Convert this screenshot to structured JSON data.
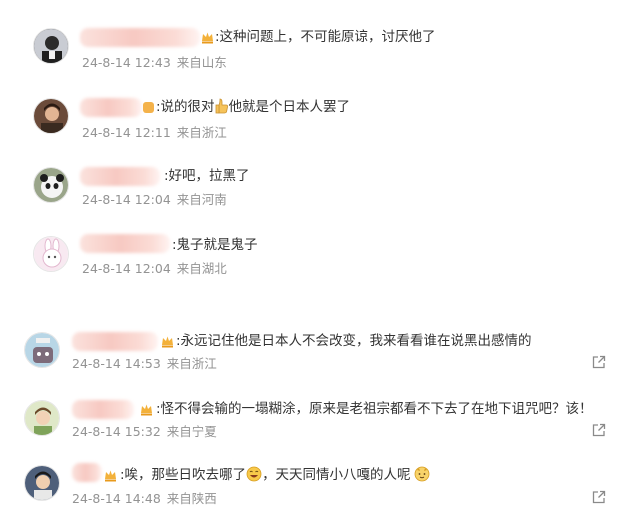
{
  "comments": [
    {
      "text": ":这种问题上，不可能原谅，讨厌他了",
      "time": "24-8-14 12:43",
      "location": "来自山东"
    },
    {
      "text_a": ":说的很对",
      "text_b": "他就是个日本人罢了",
      "time": "24-8-14 12:11",
      "location": "来自浙江"
    },
    {
      "text": ":好吧，拉黑了",
      "time": "24-8-14 12:04",
      "location": "来自河南"
    },
    {
      "text": ":鬼子就是鬼子",
      "time": "24-8-14 12:04",
      "location": "来自湖北"
    },
    {
      "text": ":永远记住他是日本人不会改变，我来看看谁在说黑出感情的",
      "time": "24-8-14 14:53",
      "location": "来自浙江"
    },
    {
      "text": ":怪不得会输的一塌糊涂，原来是老祖宗都看不下去了在地下诅咒吧？该！",
      "time": "24-8-14 15:32",
      "location": "来自宁夏"
    },
    {
      "text_a": ":唉，那些日吹去哪了",
      "text_b": "，天天同情小八嘎的人呢",
      "time": "24-8-14 14:48",
      "location": "来自陕西"
    }
  ]
}
